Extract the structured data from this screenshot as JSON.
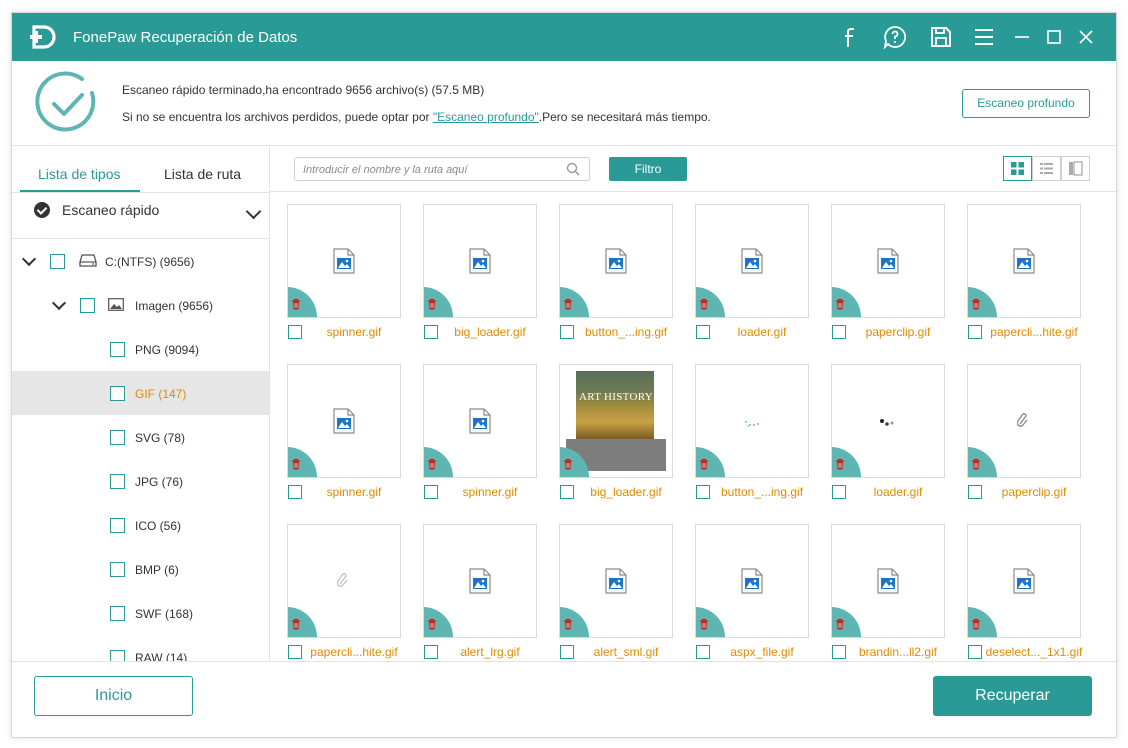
{
  "window": {
    "title": "FonePaw Recuperación de Datos",
    "accent": "#2a9a96",
    "file_name_color": "#e28a00"
  },
  "titlebar_icons": [
    "facebook-icon",
    "help-icon",
    "save-icon",
    "menu-icon",
    "minimize-icon",
    "maximize-icon",
    "close-icon"
  ],
  "info": {
    "summary": "Escaneo rápido terminado,ha encontrado 9656 archivo(s) (57.5 MB)",
    "hint_before": "Si no se encuentra los archivos perdidos, puede optar por ",
    "hint_link": "\"Escaneo profundo\"",
    "hint_after": ".Pero se necesitará más tiempo.",
    "deep_scan_button": "Escaneo profundo"
  },
  "sidebar": {
    "tabs": [
      "Lista de tipos",
      "Lista de ruta"
    ],
    "scan_mode": "Escaneo rápido",
    "drive": "C:(NTFS) (9656)",
    "category": "Imagen (9656)",
    "types": [
      {
        "label": "PNG (9094)"
      },
      {
        "label": "GIF (147)",
        "selected": true
      },
      {
        "label": "SVG (78)"
      },
      {
        "label": "JPG (76)"
      },
      {
        "label": "ICO (56)"
      },
      {
        "label": "BMP (6)"
      },
      {
        "label": "SWF (168)"
      },
      {
        "label": "RAW (14)"
      }
    ]
  },
  "toolbar": {
    "search_placeholder": "Introducir el nombre y la ruta aquí",
    "filter_button": "Filtro",
    "views": [
      "grid-view-icon",
      "list-view-icon",
      "detail-view-icon"
    ],
    "active_view": "grid-view-icon"
  },
  "files": [
    {
      "name": "spinner.gif",
      "thumb": "placeholder"
    },
    {
      "name": "big_loader.gif",
      "thumb": "placeholder"
    },
    {
      "name": "button_...ing.gif",
      "thumb": "placeholder"
    },
    {
      "name": "loader.gif",
      "thumb": "placeholder"
    },
    {
      "name": "paperclip.gif",
      "thumb": "placeholder"
    },
    {
      "name": "papercli...hite.gif",
      "thumb": "placeholder"
    },
    {
      "name": "spinner.gif",
      "thumb": "placeholder"
    },
    {
      "name": "spinner.gif",
      "thumb": "placeholder"
    },
    {
      "name": "big_loader.gif",
      "thumb": "art",
      "art_title": "ART HISTORY"
    },
    {
      "name": "button_...ing.gif",
      "thumb": "dots"
    },
    {
      "name": "loader.gif",
      "thumb": "spinner-dots"
    },
    {
      "name": "paperclip.gif",
      "thumb": "clip"
    },
    {
      "name": "papercli...hite.gif",
      "thumb": "clip-light"
    },
    {
      "name": "alert_lrg.gif",
      "thumb": "placeholder"
    },
    {
      "name": "alert_sml.gif",
      "thumb": "placeholder"
    },
    {
      "name": "aspx_file.gif",
      "thumb": "placeholder"
    },
    {
      "name": "brandin...ll2.gif",
      "thumb": "placeholder"
    },
    {
      "name": "deselect..._1x1.gif",
      "thumb": "placeholder"
    }
  ],
  "footer": {
    "home_button": "Inicio",
    "recover_button": "Recuperar"
  }
}
